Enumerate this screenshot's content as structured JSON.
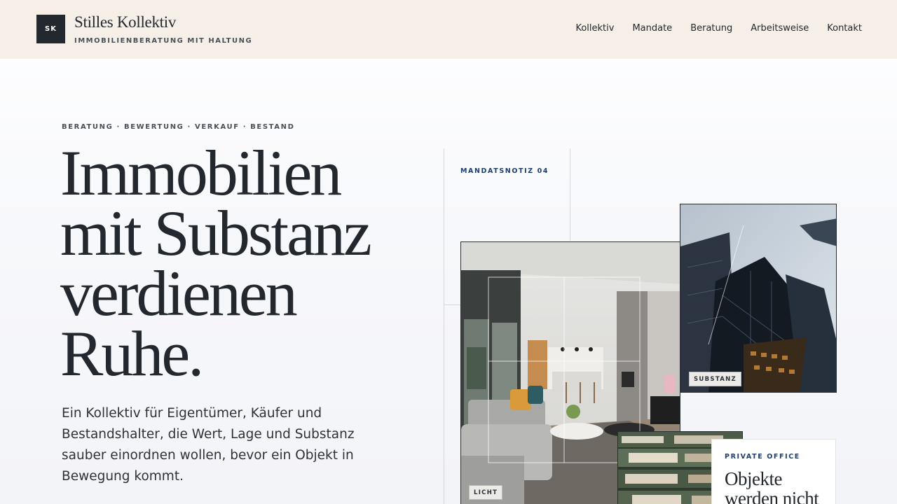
{
  "header": {
    "logo_initials": "SK",
    "brand_name": "Stilles Kollektiv",
    "tagline": "IMMOBILIENBERATUNG MIT HALTUNG",
    "nav": [
      "Kollektiv",
      "Mandate",
      "Beratung",
      "Arbeitsweise",
      "Kontakt"
    ]
  },
  "hero": {
    "eyebrow": "BERATUNG · BEWERTUNG · VERKAUF · BESTAND",
    "headline_lines": [
      "Immobilien",
      "mit Substanz",
      "verdienen",
      "Ruhe."
    ],
    "lead": "Ein Kollektiv für Eigentümer, Käufer und Bestandshalter, die Wert, Lage und Substanz sauber einordnen wollen, bevor ein Objekt in Bewegung kommt."
  },
  "collage": {
    "note_label": "MANDATSNOTIZ 04",
    "tags": {
      "interior": "LICHT",
      "towers": "SUBSTANZ"
    },
    "card": {
      "eyebrow": "PRIVATE OFFICE",
      "title": "Objekte werden nicht"
    }
  },
  "colors": {
    "header_bg": "#f6efe8",
    "ink": "#23282f",
    "accent_navy": "#1f3f6b"
  }
}
